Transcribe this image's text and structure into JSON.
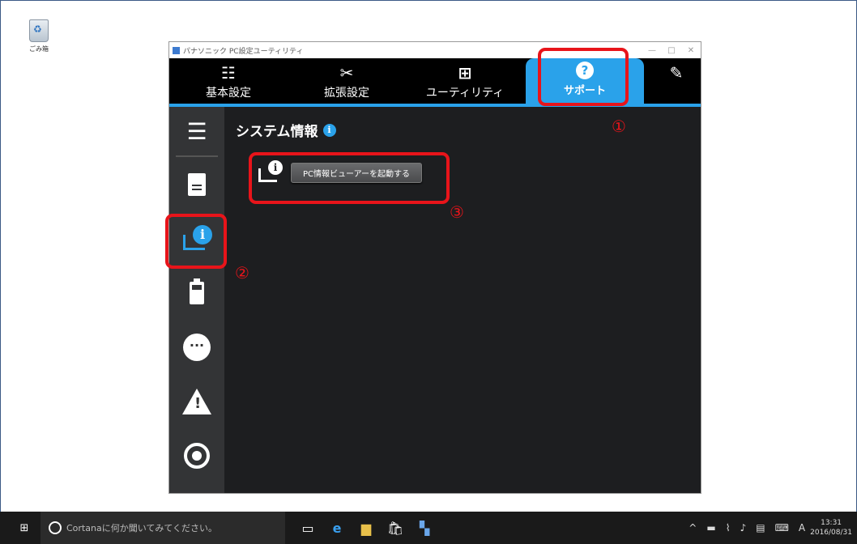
{
  "desktop": {
    "recycle_label": "ごみ箱"
  },
  "window": {
    "title": "パナソニック PC設定ユーティリティ",
    "minimize": "—",
    "maximize": "□",
    "close": "✕"
  },
  "tabs": [
    {
      "label": "基本設定",
      "icon": "☷"
    },
    {
      "label": "拡張設定",
      "icon": "✂"
    },
    {
      "label": "ユーティリティ",
      "icon": "⊞"
    },
    {
      "label": "サポート",
      "icon": "?"
    },
    {
      "label": "",
      "icon": "✎"
    }
  ],
  "sidebar": {
    "menu_icon": "☰"
  },
  "content": {
    "heading": "システム情報",
    "info_glyph": "i",
    "launch_button": "PC情報ビューアーを起動する"
  },
  "annotations": {
    "n1": "①",
    "n2": "②",
    "n3": "③"
  },
  "taskbar": {
    "search_text": "Cortanaに何か聞いてみてください。",
    "ime": "A",
    "time": "13:31",
    "date": "2016/08/31"
  },
  "colors": {
    "accent": "#2aa2ea",
    "annotation": "#e8141a"
  }
}
